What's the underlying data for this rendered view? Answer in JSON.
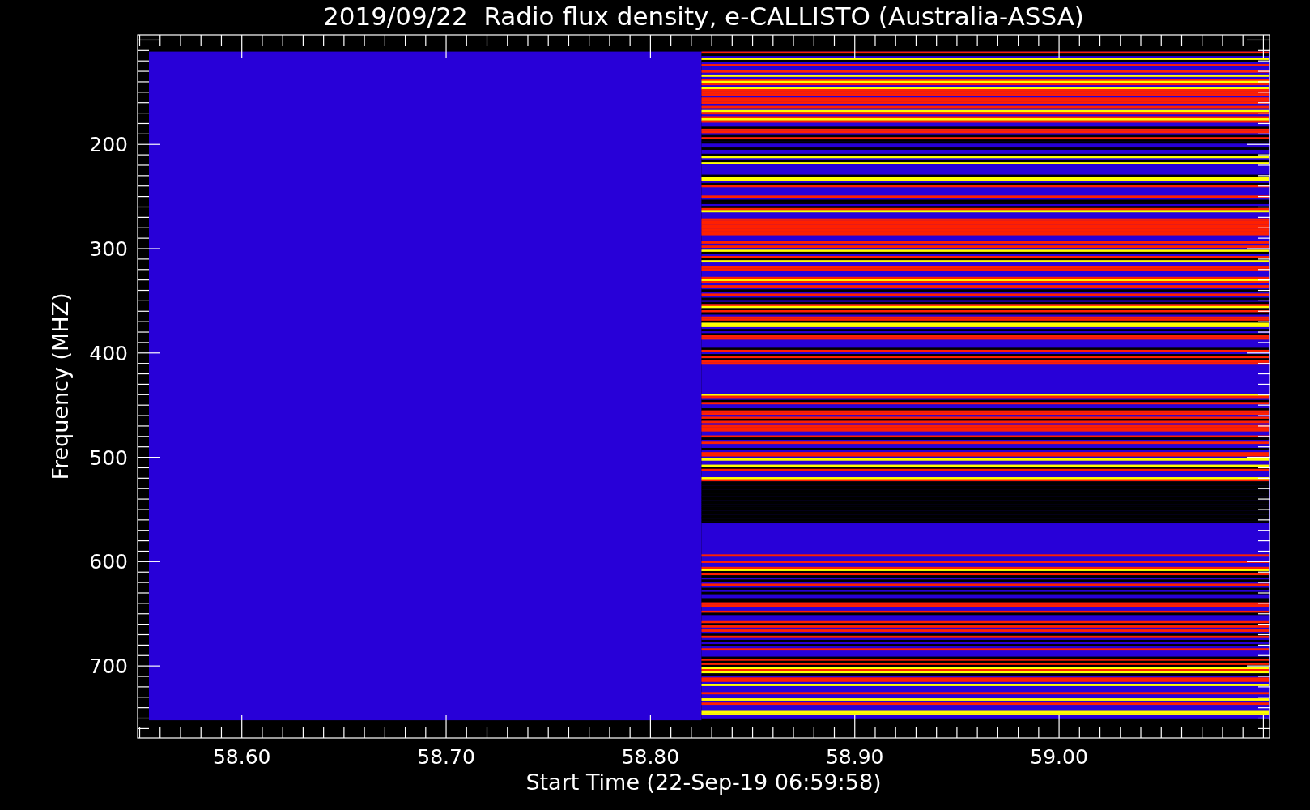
{
  "title": "2019/09/22  Radio flux density, e-CALLISTO (Australia-ASSA)",
  "y_axis": {
    "label": "Frequency (MHZ)",
    "ticks": [
      "200",
      "300",
      "400",
      "500",
      "600",
      "700"
    ]
  },
  "x_axis": {
    "label": "Start Time (22-Sep-19 06:59:58)",
    "ticks": [
      "58.60",
      "58.70",
      "58.80",
      "58.90",
      "59.00"
    ]
  }
}
